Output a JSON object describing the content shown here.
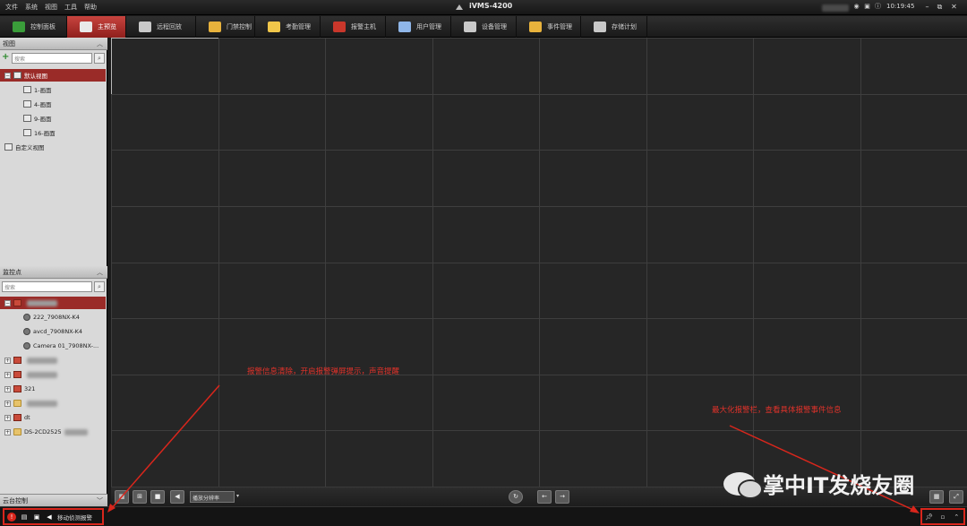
{
  "menu": [
    "文件",
    "系统",
    "视图",
    "工具",
    "帮助"
  ],
  "app_title": "iVMS-4200",
  "clock": "10:19:45",
  "modules": [
    {
      "label": "控制面板",
      "icon": "grid-icon",
      "color": "#3a9d3a"
    },
    {
      "label": "主预览",
      "icon": "monitor-icon",
      "color": "#e9e9e9",
      "active": true
    },
    {
      "label": "远程回放",
      "icon": "playback-icon",
      "color": "#c9c9c9"
    },
    {
      "label": "门禁控制",
      "icon": "door-icon",
      "color": "#e8b23c"
    },
    {
      "label": "考勤管理",
      "icon": "attendance-icon",
      "color": "#f0c64a"
    },
    {
      "label": "报警主机",
      "icon": "alarm-host-icon",
      "color": "#c9372b"
    },
    {
      "label": "用户管理",
      "icon": "user-icon",
      "color": "#8fb6e8"
    },
    {
      "label": "设备管理",
      "icon": "device-icon",
      "color": "#c9c9c9"
    },
    {
      "label": "事件管理",
      "icon": "event-icon",
      "color": "#e8b23c"
    },
    {
      "label": "存储计划",
      "icon": "storage-icon",
      "color": "#c9c9c9"
    }
  ],
  "view_panel": {
    "title": "视图",
    "search_placeholder": "搜索",
    "items": [
      {
        "label": "默认视图",
        "level": 0,
        "selected": true
      },
      {
        "label": "1-画面",
        "level": 1
      },
      {
        "label": "4-画面",
        "level": 1
      },
      {
        "label": "9-画面",
        "level": 1
      },
      {
        "label": "16-画面",
        "level": 1
      },
      {
        "label": "自定义视图",
        "level": 0
      }
    ]
  },
  "camera_panel": {
    "title": "监控点",
    "search_placeholder": "搜索",
    "items": [
      {
        "label": "",
        "level": 0,
        "type": "device",
        "selected": true
      },
      {
        "label": "222_7908NX-K4",
        "level": 1,
        "type": "camera"
      },
      {
        "label": "avcd_7908NX-K4",
        "level": 1,
        "type": "camera"
      },
      {
        "label": "Camera 01_7908NX-...",
        "level": 1,
        "type": "camera"
      },
      {
        "label": "",
        "level": 0,
        "type": "device"
      },
      {
        "label": "",
        "level": 0,
        "type": "device"
      },
      {
        "label": "321",
        "level": 0,
        "type": "device"
      },
      {
        "label": "",
        "level": 0,
        "type": "folder"
      },
      {
        "label": "dt",
        "level": 0,
        "type": "device"
      },
      {
        "label": "DS-2CD2525",
        "level": 0,
        "type": "folder"
      }
    ]
  },
  "ptz_panel": {
    "title": "云台控制"
  },
  "controls": {
    "stream_label": "播放分辨率"
  },
  "alarm_bar": {
    "motion_label": "移动侦测报警"
  },
  "annotations": {
    "left": "报警信息清除，开启报警弹屏提示，声音提醒",
    "right": "最大化报警栏，查看具体报警事件信息"
  },
  "watermark": "掌中IT发烧友圈"
}
